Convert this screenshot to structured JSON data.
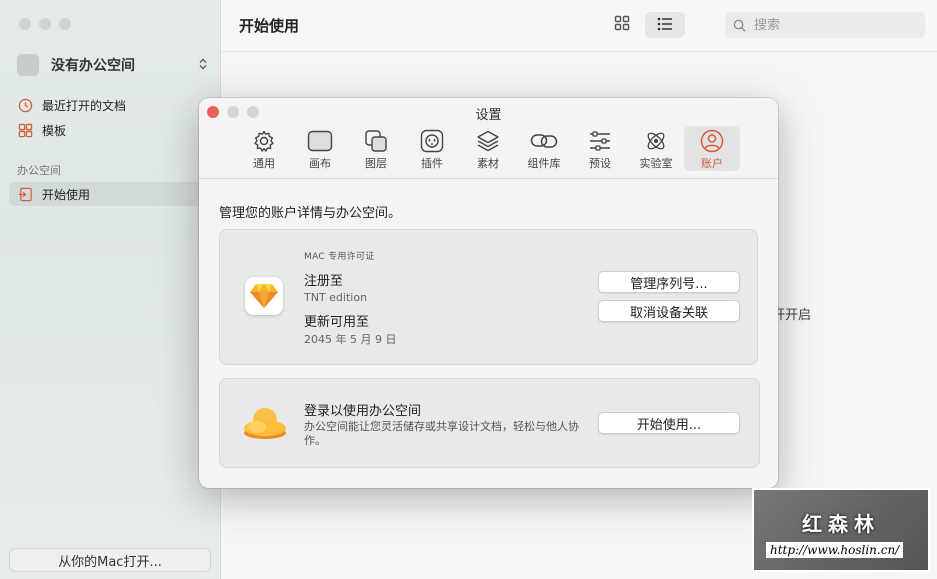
{
  "sidebar": {
    "workspace_label": "没有办公空间",
    "items": [
      {
        "label": "最近打开的文档",
        "icon": "clock-icon"
      },
      {
        "label": "模板",
        "icon": "template-grid-icon"
      }
    ],
    "section_label": "办公空间",
    "active_item": {
      "label": "开始使用",
      "icon": "enter-icon"
    },
    "open_from_mac_label": "从你的Mac打开..."
  },
  "header": {
    "title": "开始使用",
    "search_placeholder": "搜索"
  },
  "background_text": "开开启",
  "settings": {
    "title": "设置",
    "tabs": [
      {
        "label": "通用",
        "icon": "gear-icon"
      },
      {
        "label": "画布",
        "icon": "canvas-icon"
      },
      {
        "label": "图层",
        "icon": "layers-icon"
      },
      {
        "label": "插件",
        "icon": "plug-icon"
      },
      {
        "label": "素材",
        "icon": "stack-icon"
      },
      {
        "label": "组件库",
        "icon": "link-icon"
      },
      {
        "label": "预设",
        "icon": "sliders-icon"
      },
      {
        "label": "实验室",
        "icon": "atom-icon"
      },
      {
        "label": "账户",
        "icon": "user-icon"
      }
    ],
    "active_tab": "账户",
    "description": "管理您的账户详情与办公空间。",
    "license": {
      "kicker": "MAC 专用许可证",
      "registered_to_label": "注册至",
      "registered_to_value": "TNT edition",
      "updates_label": "更新可用至",
      "updates_value": "2045 年 5 月 9 日",
      "manage_serial_button": "管理序列号...",
      "unlink_device_button": "取消设备关联"
    },
    "login": {
      "heading": "登录以使用办公空间",
      "body": "办公空间能让您灵活储存或共享设计文档，轻松与他人协作。",
      "start_button": "开始使用..."
    },
    "colors": {
      "close": "#ec5f57",
      "accent": "#d25a3a"
    }
  },
  "watermark": {
    "title": "红森林",
    "url": "http://www.hoslin.cn/"
  }
}
